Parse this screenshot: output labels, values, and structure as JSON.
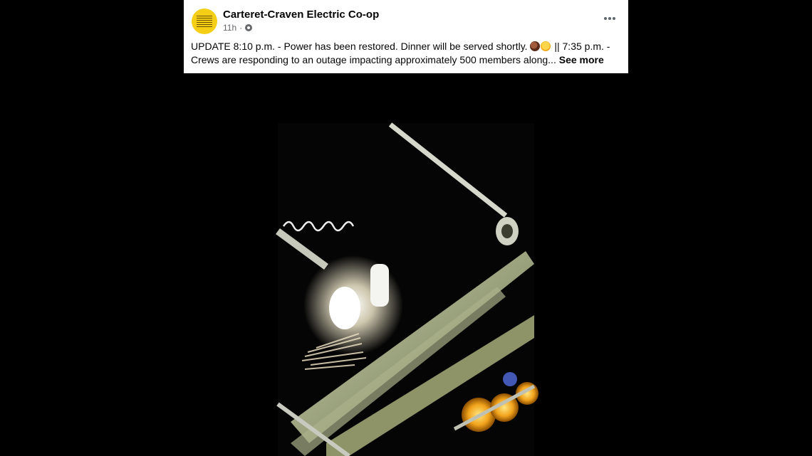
{
  "post": {
    "page_name": "Carteret-Craven Electric Co-op",
    "time": "11h",
    "separator": "·",
    "privacy_icon": "globe-icon",
    "more_icon": "more-options-icon",
    "text_part1": "UPDATE 8:10 p.m. - Power has been restored. Dinner will be served shortly.",
    "emoji_1": "plate-icon",
    "emoji_2": "laughing-face-icon",
    "text_part2": "|| 7:35 p.m. - Crews are responding to an outage impacting approximately 500 members along...",
    "see_more": "See more"
  },
  "photo": {
    "subject": "utility-pole-with-arcing-equipment-at-night"
  },
  "colors": {
    "background": "#000000",
    "card": "#ffffff",
    "avatar": "#f5cf16",
    "text": "#050505",
    "meta": "#65676b"
  }
}
